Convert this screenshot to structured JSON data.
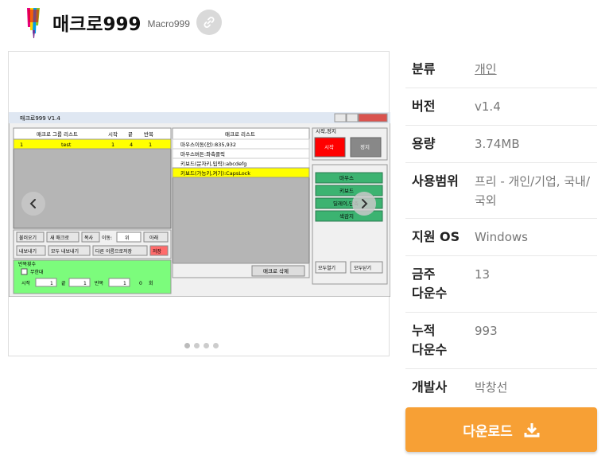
{
  "app": {
    "title": "매크로999",
    "subtitle": "Macro999"
  },
  "icons": {
    "link": "link-icon",
    "prev": "chevron-left-icon",
    "next": "chevron-right-icon",
    "download": "download-icon"
  },
  "info": [
    {
      "label": "분류",
      "value": "개인",
      "link": true
    },
    {
      "label": "버전",
      "value": "v1.4"
    },
    {
      "label": "용량",
      "value": "3.74MB"
    },
    {
      "label": "사용범위",
      "value": "프리 - 개인/기업, 국내/국외"
    },
    {
      "label": "지원 OS",
      "value": "Windows"
    },
    {
      "label": "금주 다운수",
      "value": "13"
    },
    {
      "label": "누적 다운수",
      "value": "993"
    },
    {
      "label": "개발사",
      "value": "박창선"
    }
  ],
  "download_label": "다운로드",
  "carousel": {
    "slides": 4,
    "active": 0
  },
  "screenshot": {
    "window_title": "매크로999 V1.4",
    "group_header": [
      "매크로 그룹 리스트",
      "시작",
      "끝",
      "반복"
    ],
    "group_row": [
      "1",
      "test",
      "1",
      "4",
      "1"
    ],
    "macro_header": "매크로 리스트",
    "macro_rows": [
      "마우스이동(전):835,932",
      "마우스버튼:좌측클릭",
      "키보드(문자키,입력):abcdefg",
      "키보드(가능키,켜기):CapsLock"
    ],
    "start_stop_label": "시작,정지",
    "start": "시작",
    "stop": "정지",
    "side_buttons": [
      "마우스",
      "키보드",
      "딜레이,단축",
      "색감지"
    ],
    "open_all": "모두열기",
    "close_all": "모두닫기",
    "buttons1": [
      "불러오기",
      "새 매크로",
      "복사",
      "이동:",
      "위",
      "아래"
    ],
    "buttons2": [
      "내보내기",
      "모두 내보내기",
      "다른 이름으로저장",
      "저장"
    ],
    "delete_macro": "매크로 삭제",
    "repeat_label": "반복횟수",
    "infinite": "무한대",
    "start_label": "시작",
    "start_val": "1",
    "end_label": "끝",
    "end_val": "1",
    "repeat_field_label": "반복",
    "repeat_val": "1",
    "zero": "0",
    "times": "회"
  }
}
